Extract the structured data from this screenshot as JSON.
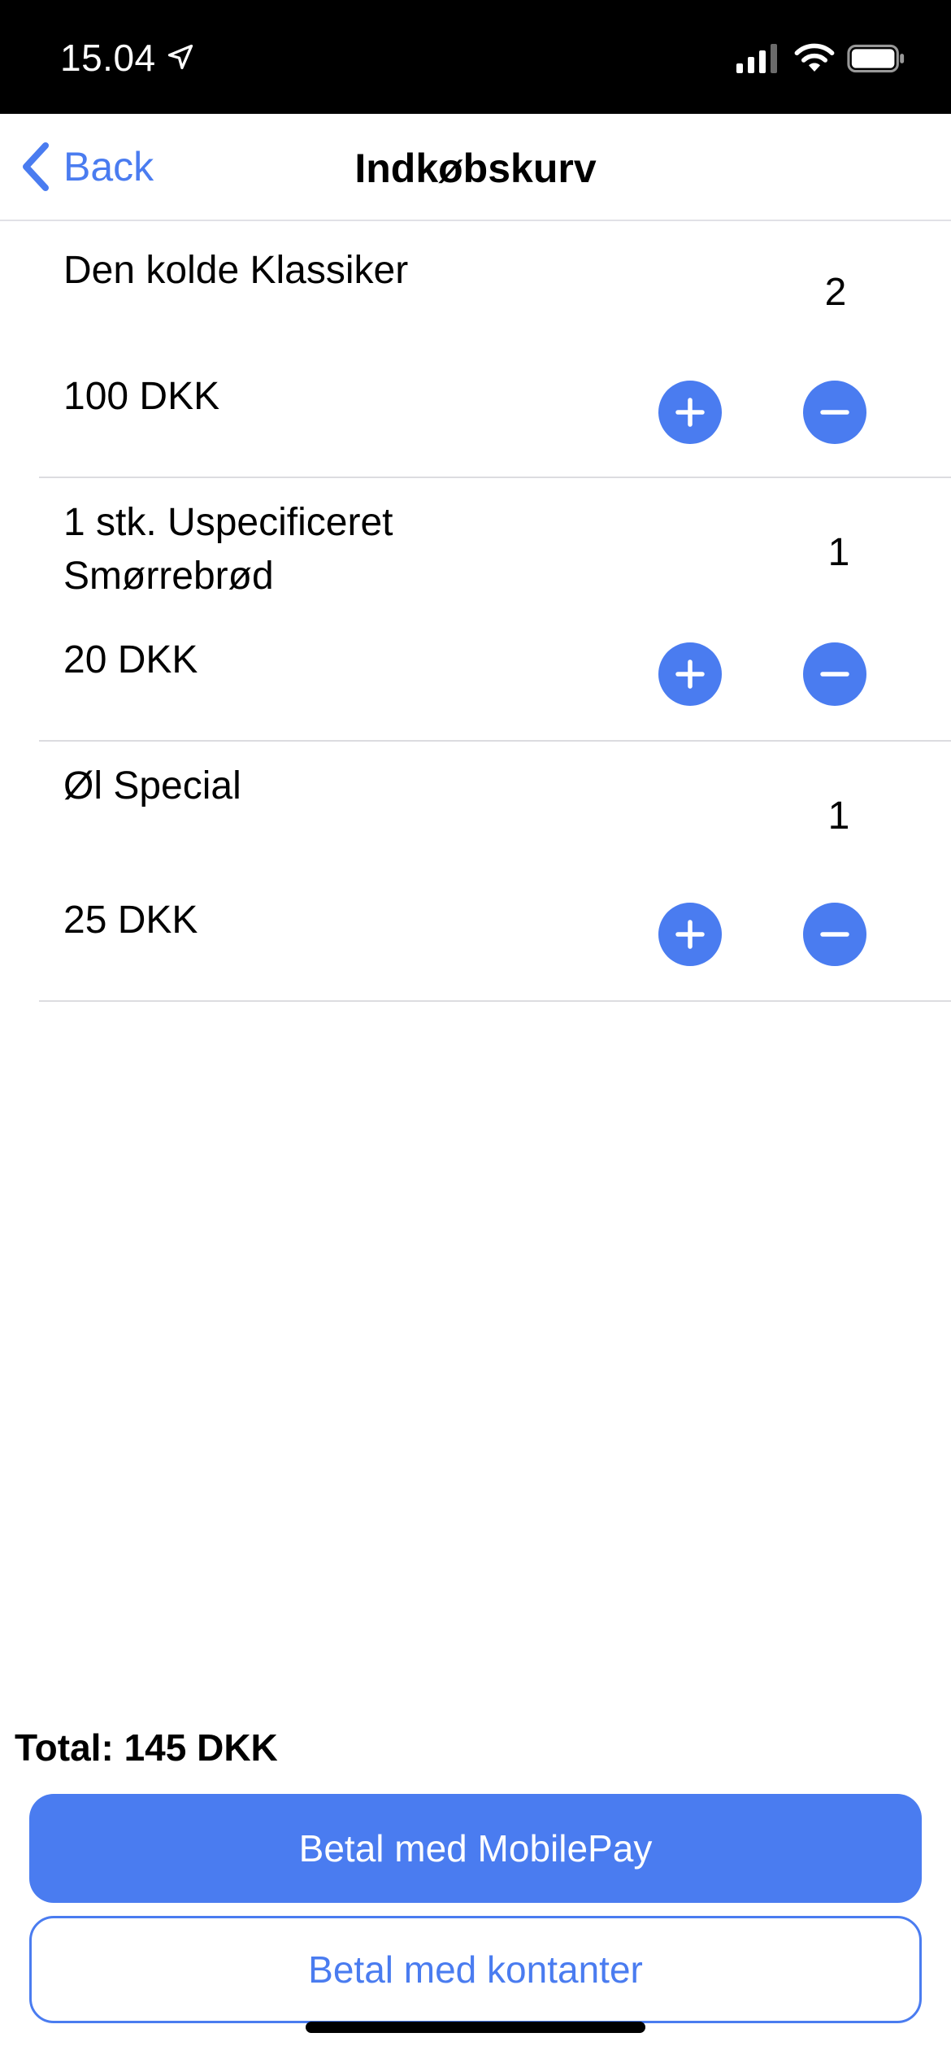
{
  "status_bar": {
    "time": "15.04",
    "icons": [
      "location-arrow-icon",
      "cellular-signal-icon",
      "wifi-icon",
      "battery-icon"
    ]
  },
  "nav": {
    "back_label": "Back",
    "title": "Indkøbskurv"
  },
  "cart": {
    "items": [
      {
        "name": "Den kolde Klassiker",
        "price": "100 DKK",
        "quantity": "2"
      },
      {
        "name": "1 stk. Uspecificeret Smørrebrød",
        "price": "20 DKK",
        "quantity": "1"
      },
      {
        "name": "Øl Special",
        "price": "25 DKK",
        "quantity": "1"
      }
    ]
  },
  "footer": {
    "total": "Total: 145 DKK",
    "pay_mobilepay": "Betal med MobilePay",
    "pay_cash": "Betal med kontanter"
  },
  "colors": {
    "accent": "#4a7cf0",
    "status_bar_bg": "#000000",
    "separator": "#dcdce0"
  }
}
